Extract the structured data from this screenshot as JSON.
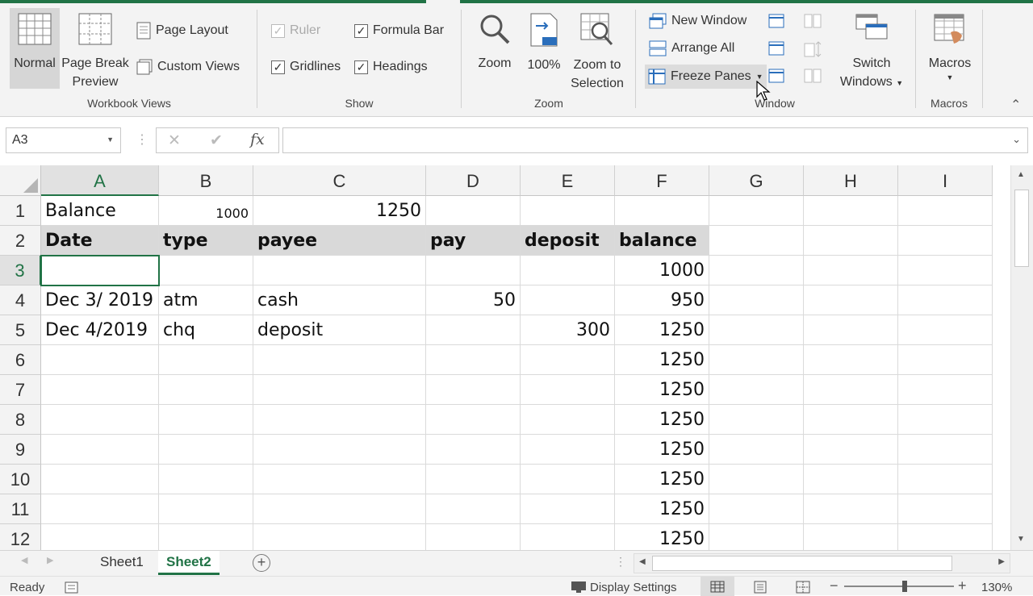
{
  "ribbon": {
    "workbook_views": {
      "label": "Workbook Views",
      "normal": "Normal",
      "page_break_1": "Page Break",
      "page_break_2": "Preview",
      "page_layout": "Page Layout",
      "custom_views": "Custom Views"
    },
    "show": {
      "label": "Show",
      "ruler": "Ruler",
      "formula_bar": "Formula Bar",
      "gridlines": "Gridlines",
      "headings": "Headings"
    },
    "zoom": {
      "label": "Zoom",
      "zoom": "Zoom",
      "hundred": "100%",
      "zoom_sel_1": "Zoom to",
      "zoom_sel_2": "Selection"
    },
    "window": {
      "label": "Window",
      "new_window": "New Window",
      "arrange_all": "Arrange All",
      "freeze_panes": "Freeze Panes",
      "switch_1": "Switch",
      "switch_2": "Windows"
    },
    "macros": {
      "label": "Macros",
      "macros": "Macros"
    }
  },
  "formula_bar": {
    "name_box": "A3",
    "fx": "fx",
    "cancel": "✕",
    "enter": "✔",
    "formula": ""
  },
  "columns": [
    "A",
    "B",
    "C",
    "D",
    "E",
    "F",
    "G",
    "H",
    "I"
  ],
  "rows": [
    "1",
    "2",
    "3",
    "4",
    "5",
    "6",
    "7",
    "8",
    "9",
    "10",
    "11",
    "12"
  ],
  "cells": {
    "r1": {
      "a": "Balance",
      "b": "1000",
      "c": "1250"
    },
    "r2": {
      "a": "Date",
      "b": "type",
      "c": "payee",
      "d": "pay",
      "e": "deposit",
      "f": "balance"
    },
    "r3": {
      "f": "1000"
    },
    "r4": {
      "a": "Dec 3/ 2019",
      "b": "atm",
      "c": "cash",
      "d": "50",
      "f": "950"
    },
    "r5": {
      "a": "Dec 4/2019",
      "b": "chq",
      "c": "deposit",
      "e": "300",
      "f": "1250"
    },
    "r6": {
      "f": "1250"
    },
    "r7": {
      "f": "1250"
    },
    "r8": {
      "f": "1250"
    },
    "r9": {
      "f": "1250"
    },
    "r10": {
      "f": "1250"
    },
    "r11": {
      "f": "1250"
    },
    "r12": {
      "f": "1250"
    }
  },
  "sheets": {
    "sheet1": "Sheet1",
    "sheet2": "Sheet2",
    "active": "Sheet2"
  },
  "status": {
    "ready": "Ready",
    "display_settings": "Display Settings",
    "zoom": "130%"
  },
  "colors": {
    "accent": "#217346",
    "header_fill": "#d9d9d9"
  }
}
